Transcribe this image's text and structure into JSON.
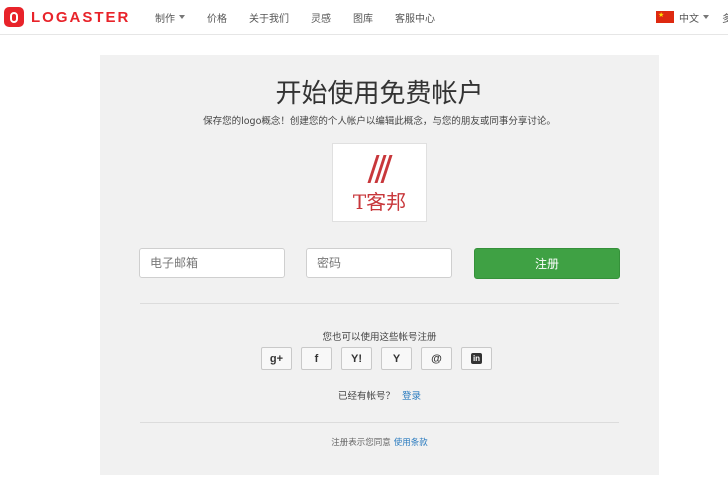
{
  "brand": {
    "name": "LOGASTER",
    "color": "#e8232a"
  },
  "nav": {
    "items": [
      {
        "label": "制作",
        "has_dropdown": true
      },
      {
        "label": "价格"
      },
      {
        "label": "关于我们"
      },
      {
        "label": "灵感"
      },
      {
        "label": "图库"
      },
      {
        "label": "客服中心"
      }
    ],
    "language": {
      "label": "中文",
      "flag": "cn-flag-icon"
    },
    "edge_text": "多"
  },
  "signup": {
    "title": "开始使用免费帐户",
    "subtitle": "保存您的logo概念！创建您的个人帐户以编辑此概念，与您的朋友或同事分享讨论。",
    "logo_preview": {
      "name": "T客邦",
      "color": "#c8373b"
    },
    "email_placeholder": "电子邮箱",
    "password_placeholder": "密码",
    "register_label": "注册",
    "register_color": "#3fa144",
    "social_label": "您也可以使用这些帐号注册",
    "social": [
      {
        "id": "google",
        "icon": "google-plus-icon",
        "glyph": "g+"
      },
      {
        "id": "facebook",
        "icon": "facebook-icon",
        "glyph": "f"
      },
      {
        "id": "yahoo",
        "icon": "yahoo-icon",
        "glyph": "Y!"
      },
      {
        "id": "yandex",
        "icon": "yandex-icon",
        "glyph": "Y"
      },
      {
        "id": "email",
        "icon": "at-icon",
        "glyph": "@"
      },
      {
        "id": "linkedin",
        "icon": "linkedin-icon",
        "glyph": "in"
      }
    ],
    "login_prompt": "已经有帐号？",
    "login_link": "登录",
    "terms_text": "注册表示您同意",
    "terms_link": "使用条款"
  }
}
